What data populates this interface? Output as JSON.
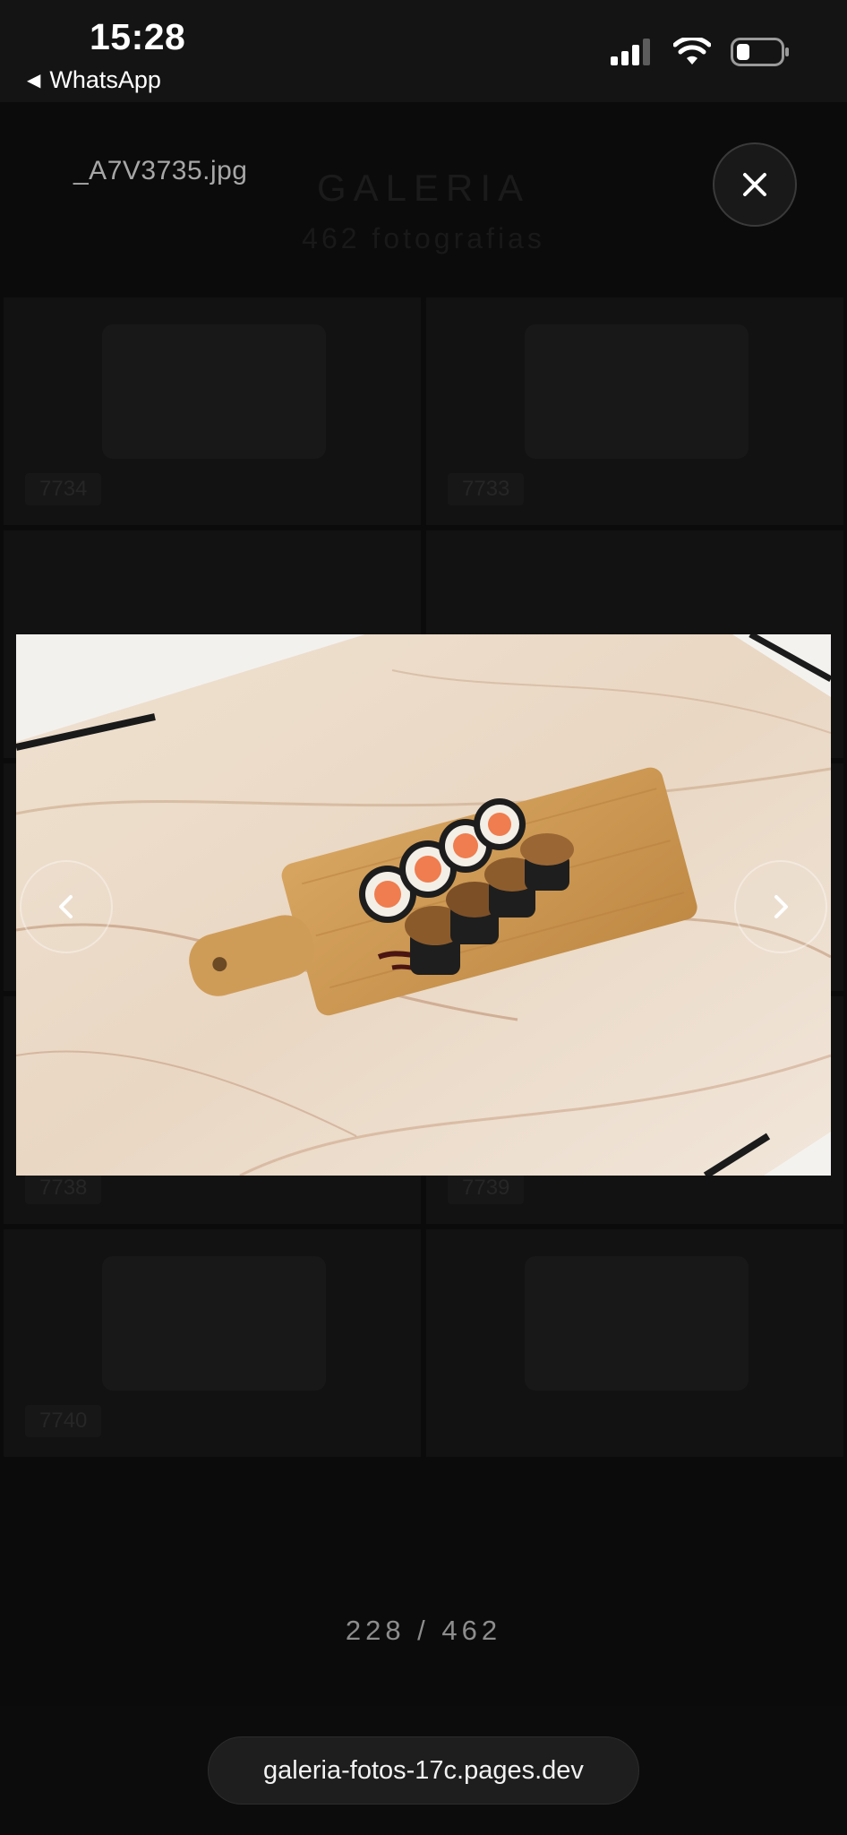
{
  "status_bar": {
    "time": "15:28",
    "back_app": "WhatsApp",
    "icons": [
      "signal-icon",
      "wifi-icon",
      "battery-icon"
    ]
  },
  "gallery": {
    "title": "GALERIA",
    "count": "462 fotografias",
    "tiles": [
      {
        "label": "7734"
      },
      {
        "label": "7733"
      },
      {
        "label": ""
      },
      {
        "label": ""
      },
      {
        "label": ""
      },
      {
        "label": ""
      },
      {
        "label": "7738"
      },
      {
        "label": "7739"
      },
      {
        "label": "7740"
      },
      {
        "label": ""
      },
      {
        "label": ""
      },
      {
        "label": ""
      }
    ]
  },
  "lightbox": {
    "file_name": "_A7V3735.jpg",
    "counter": "228 / 462",
    "close_icon": "close-icon",
    "prev_icon": "chevron-left-icon",
    "next_icon": "chevron-right-icon",
    "photo_alt": "sushi rolls on wooden board"
  },
  "browser": {
    "url": "galeria-fotos-17c.pages.dev"
  },
  "colors": {
    "background": "#070707",
    "status_bar": "#141414",
    "counter_text": "#8d8d8d"
  }
}
